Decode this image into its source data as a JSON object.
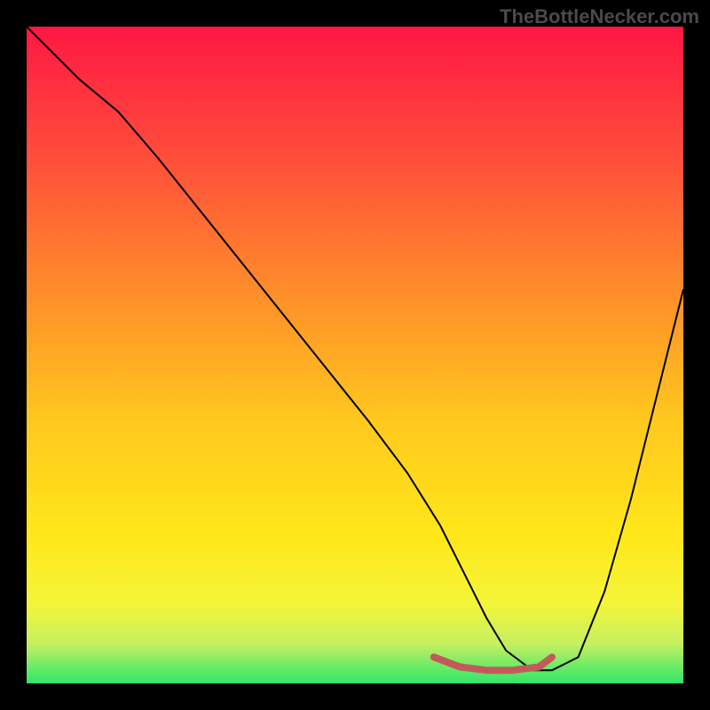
{
  "watermark": "TheBottleNecker.com",
  "chart_data": {
    "type": "line",
    "title": "",
    "xlabel": "",
    "ylabel": "",
    "xlim": [
      0,
      100
    ],
    "ylim": [
      0,
      100
    ],
    "gradient_stops": [
      {
        "offset": 0,
        "color": "#ff1744"
      },
      {
        "offset": 20,
        "color": "#ff4e3a"
      },
      {
        "offset": 40,
        "color": "#ff8c2a"
      },
      {
        "offset": 60,
        "color": "#ffc81e"
      },
      {
        "offset": 78,
        "color": "#ffe81a"
      },
      {
        "offset": 88,
        "color": "#f3f53a"
      },
      {
        "offset": 94,
        "color": "#c4f060"
      },
      {
        "offset": 100,
        "color": "#2ee66b"
      }
    ],
    "series": [
      {
        "name": "bottleneck-curve",
        "color": "#000000",
        "width": 2,
        "x": [
          0,
          4,
          8,
          14,
          20,
          28,
          36,
          44,
          52,
          58,
          63,
          67,
          70,
          73,
          77,
          80,
          84,
          88,
          92,
          96,
          100
        ],
        "y": [
          100,
          96,
          92,
          87,
          80,
          70,
          60,
          50,
          40,
          32,
          24,
          16,
          10,
          5,
          2,
          2,
          4,
          14,
          28,
          44,
          60
        ]
      },
      {
        "name": "marker-band",
        "color": "#c15b5b",
        "width": 8,
        "cap": "round",
        "x": [
          62,
          66,
          70,
          74,
          78,
          80
        ],
        "y": [
          4,
          2.5,
          2,
          2,
          2.5,
          4
        ]
      }
    ]
  }
}
